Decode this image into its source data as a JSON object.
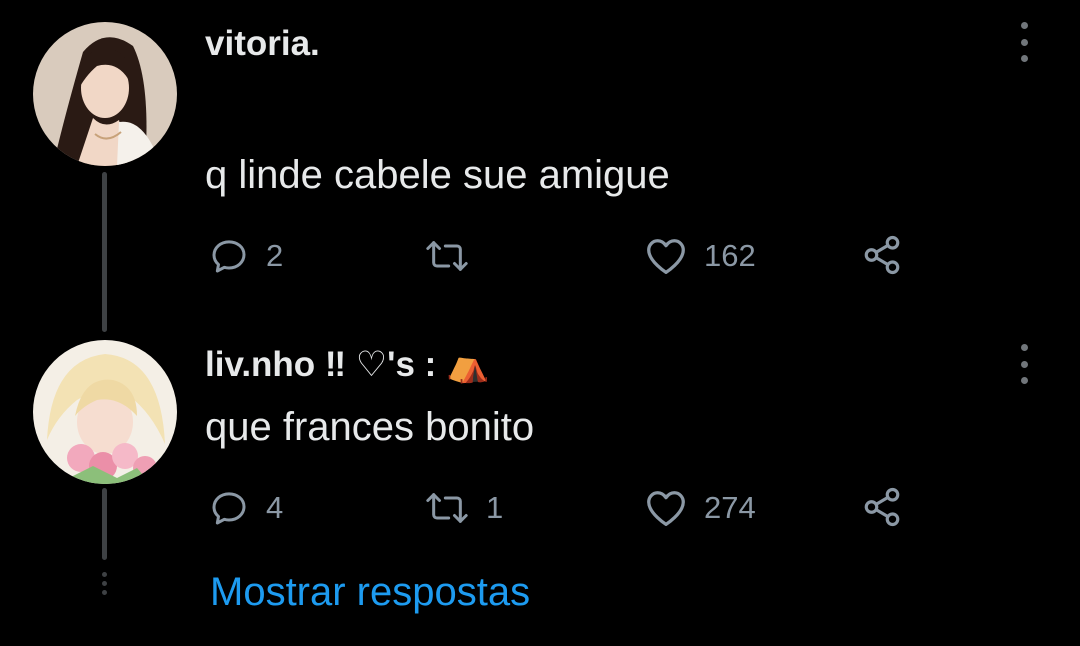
{
  "replies": [
    {
      "username": "vitoria.",
      "text": "q linde cabele sue amigue",
      "reply_count": "2",
      "retweet_count": "",
      "like_count": "162"
    },
    {
      "username": "liv.nho ‼ ♡'s : ⛺",
      "text": "que frances bonito",
      "reply_count": "4",
      "retweet_count": "1",
      "like_count": "274"
    }
  ],
  "show_replies_label": "Mostrar respostas",
  "colors": {
    "background": "#000000",
    "text": "#e7e9ea",
    "muted": "#8b98a5",
    "link": "#1d9bf0",
    "thread_line": "#3e4144"
  },
  "icons": [
    "avatar-photo",
    "more-icon",
    "reply-icon",
    "retweet-icon",
    "like-icon",
    "share-icon"
  ]
}
